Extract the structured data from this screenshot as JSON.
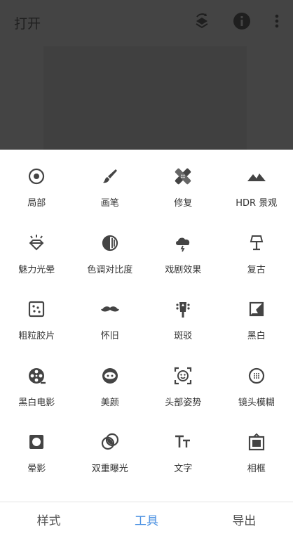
{
  "header": {
    "open_label": "打开",
    "icons": [
      "layers-icon",
      "info-icon",
      "more-vert-icon"
    ]
  },
  "tools": [
    {
      "label": "局部",
      "icon": "target-icon"
    },
    {
      "label": "画笔",
      "icon": "brush-icon"
    },
    {
      "label": "修复",
      "icon": "bandage-icon"
    },
    {
      "label": "HDR 景观",
      "icon": "mountain-icon"
    },
    {
      "label": "魅力光晕",
      "icon": "diamond-glow-icon"
    },
    {
      "label": "色调对比度",
      "icon": "tone-contrast-icon"
    },
    {
      "label": "戏剧效果",
      "icon": "storm-cloud-icon"
    },
    {
      "label": "复古",
      "icon": "lamp-icon"
    },
    {
      "label": "粗粒胶片",
      "icon": "grain-dice-icon"
    },
    {
      "label": "怀旧",
      "icon": "mustache-icon"
    },
    {
      "label": "斑驳",
      "icon": "guitar-head-icon"
    },
    {
      "label": "黑白",
      "icon": "black-white-icon"
    },
    {
      "label": "黑白电影",
      "icon": "film-reel-icon"
    },
    {
      "label": "美颜",
      "icon": "face-icon"
    },
    {
      "label": "头部姿势",
      "icon": "face-pose-icon"
    },
    {
      "label": "镜头模糊",
      "icon": "lens-blur-icon"
    },
    {
      "label": "晕影",
      "icon": "vignette-icon"
    },
    {
      "label": "双重曝光",
      "icon": "double-exposure-icon"
    },
    {
      "label": "文字",
      "icon": "text-icon"
    },
    {
      "label": "相框",
      "icon": "frame-icon"
    }
  ],
  "nav": {
    "tabs": [
      {
        "label": "样式",
        "active": false
      },
      {
        "label": "工具",
        "active": true
      },
      {
        "label": "导出",
        "active": false
      }
    ]
  },
  "colors": {
    "accent": "#4a90e2",
    "icon": "#444444",
    "overlay": "#444444"
  }
}
